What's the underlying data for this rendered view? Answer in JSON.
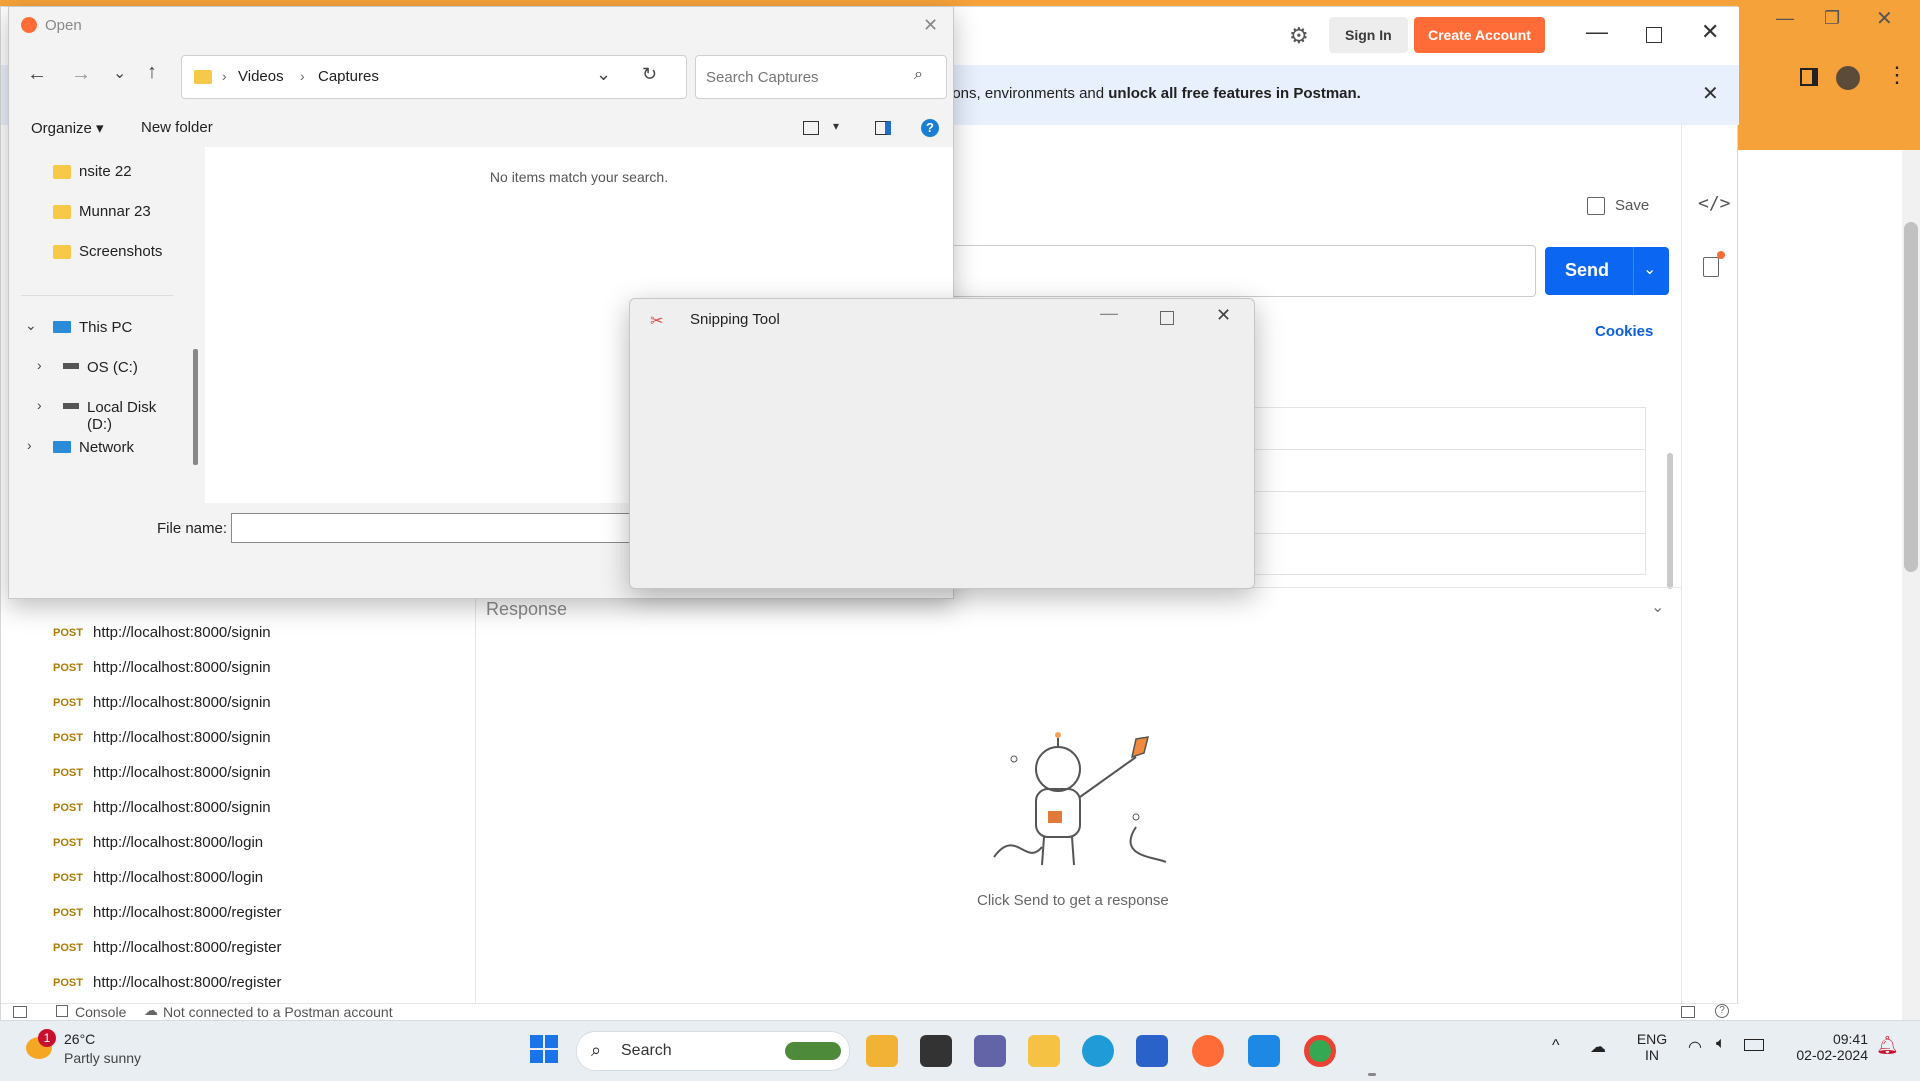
{
  "postman": {
    "topbar": {
      "sign_in": "Sign In",
      "create_account": "Create Account"
    },
    "banner": {
      "text": "ions, environments and ",
      "bold": "unlock all free features in Postman."
    },
    "save_label": "Save",
    "send_label": "Send",
    "cookies_label": "Cookies",
    "response_label": "Response",
    "response_empty": "Click Send to get a response",
    "history": [
      {
        "method": "POST",
        "url": "http://localhost:8000/signin"
      },
      {
        "method": "POST",
        "url": "http://localhost:8000/signin"
      },
      {
        "method": "POST",
        "url": "http://localhost:8000/signin"
      },
      {
        "method": "POST",
        "url": "http://localhost:8000/signin"
      },
      {
        "method": "POST",
        "url": "http://localhost:8000/signin"
      },
      {
        "method": "POST",
        "url": "http://localhost:8000/signin"
      },
      {
        "method": "POST",
        "url": "http://localhost:8000/login"
      },
      {
        "method": "POST",
        "url": "http://localhost:8000/login"
      },
      {
        "method": "POST",
        "url": "http://localhost:8000/register"
      },
      {
        "method": "POST",
        "url": "http://localhost:8000/register"
      },
      {
        "method": "POST",
        "url": "http://localhost:8000/register"
      }
    ],
    "statusbar": {
      "console": "Console",
      "connection": "Not connected to a Postman account"
    }
  },
  "open_dialog": {
    "title": "Open",
    "breadcrumb": [
      "Videos",
      "Captures"
    ],
    "search_placeholder": "Search Captures",
    "organize": "Organize",
    "new_folder": "New folder",
    "empty_message": "No items match your search.",
    "nav_folders": [
      "nsite 22",
      "Munnar 23",
      "Screenshots"
    ],
    "this_pc": "This PC",
    "drives": [
      "OS (C:)",
      "Local Disk (D:)"
    ],
    "network": "Network",
    "file_name_label": "File name:",
    "file_name_value": ""
  },
  "snipping": {
    "title": "Snipping Tool"
  },
  "taskbar": {
    "weather_temp": "26°C",
    "weather_desc": "Partly sunny",
    "weather_badge": "1",
    "search": "Search",
    "lang": "ENG",
    "region": "IN",
    "time": "09:41",
    "date": "02-02-2024"
  }
}
